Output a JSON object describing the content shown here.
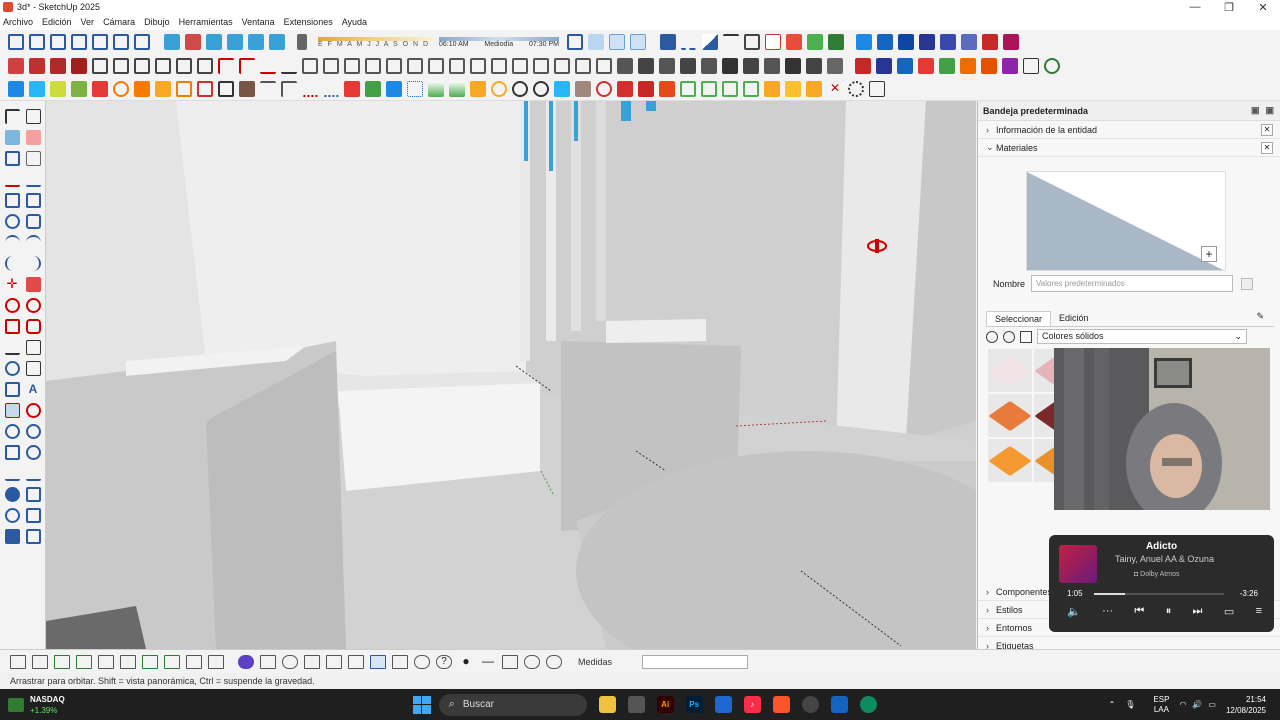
{
  "window": {
    "title": "3d* - SketchUp 2025",
    "controls": {
      "minimize": "—",
      "maximize": "❐",
      "close": "✕"
    }
  },
  "menu": [
    "Archivo",
    "Edición",
    "Ver",
    "Cámara",
    "Dibujo",
    "Herramientas",
    "Ventana",
    "Extensiones",
    "Ayuda"
  ],
  "shadows": {
    "months": "E F M A M J J A S O N D",
    "time_start": "06:10 AM",
    "time_mid": "Mediodía",
    "time_end": "07:30 PM"
  },
  "tray": {
    "title": "Bandeja predeterminada",
    "entity_info": "Información de la entidad",
    "materials": "Materiales",
    "name_label": "Nombre",
    "name_placeholder": "Valores predeterminados",
    "tab_select": "Seleccionar",
    "tab_edit": "Edición",
    "library": "Colores sólidos",
    "swatch_colors": [
      "#f1e3e6",
      "#e6b3b8",
      "#d6212a",
      "#c41e2a",
      "#f0a07a",
      "#e87a3a",
      "#7a2a2a",
      "#f0ece4",
      "#e8a050",
      "#e89a40",
      "#f59a30",
      "#e8902a"
    ],
    "components": "Componentes",
    "styles": "Estilos",
    "environments": "Entornos",
    "tags": "Etiquetas"
  },
  "media": {
    "title": "Adicto",
    "artist": "Tainy, Anuel AA & Ozuna",
    "quality": "◘ Dolby Atmos",
    "elapsed": "1:05",
    "remaining": "-3:26",
    "progress": 0.24
  },
  "bottom": {
    "measurements_label": "Medidas",
    "status": "Arrastrar para orbitar. Shift = vista panorámica, Ctrl = suspende la gravedad."
  },
  "taskbar": {
    "stock_name": "NASDAQ",
    "stock_change": "+1.39%",
    "search_placeholder": "Buscar",
    "lang_top": "ESP",
    "lang_bottom": "LAA",
    "time": "21:54",
    "date": "12/08/2025"
  },
  "colors": {
    "accent": "#3aa0d8",
    "viewport_bg": "#d6d6d6",
    "taskbar_bg": "#1f1f1f"
  }
}
